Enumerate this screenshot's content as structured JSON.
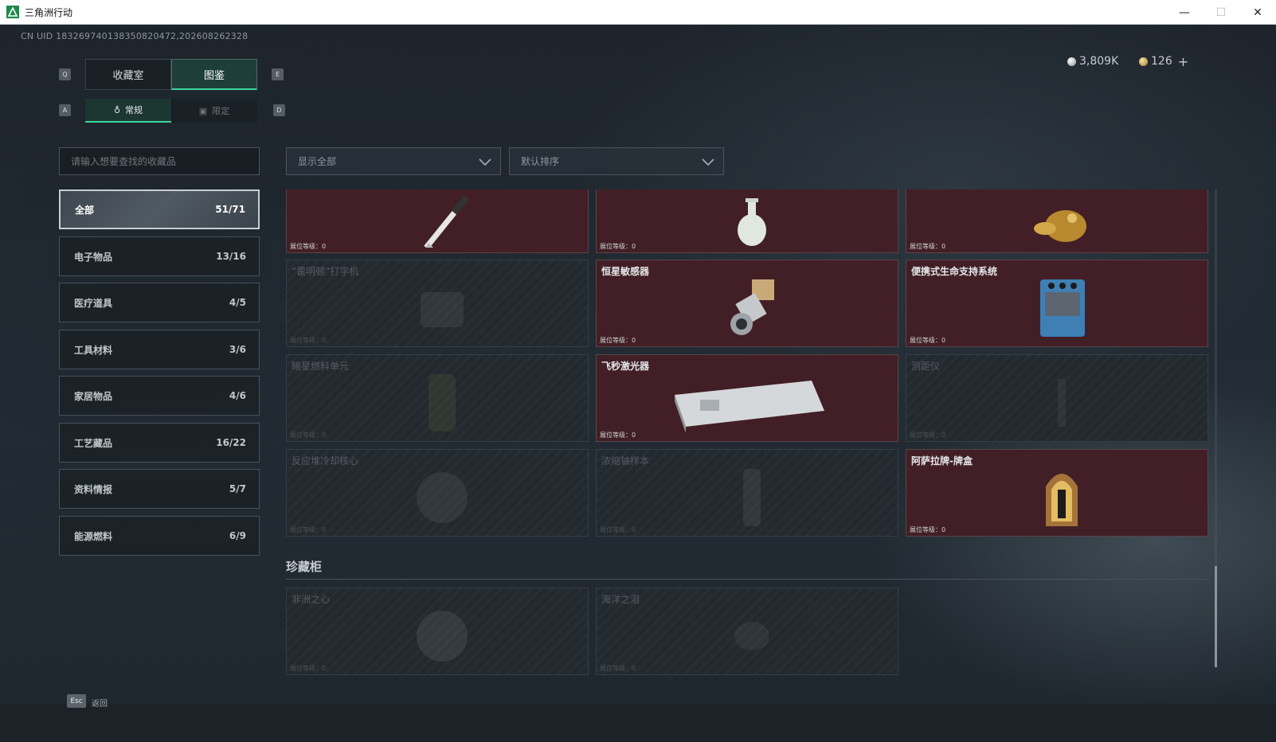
{
  "window": {
    "title": "三角洲行动"
  },
  "uid": "CN UID 183269740138350820472,202608262328",
  "currency": {
    "silver": "3,809K",
    "gold": "126",
    "add": "+"
  },
  "keys": {
    "q": "Q",
    "e": "E",
    "a": "A",
    "d": "D",
    "esc": "Esc"
  },
  "tabs": [
    {
      "label": "收藏室"
    },
    {
      "label": "图鉴"
    }
  ],
  "subtabs": [
    {
      "label": "常规"
    },
    {
      "label": "限定"
    }
  ],
  "search": {
    "placeholder": "请输入想要查找的收藏品"
  },
  "filter": {
    "label": "显示全部"
  },
  "sort": {
    "label": "默认排序"
  },
  "categories": [
    {
      "label": "全部",
      "count": "51/71"
    },
    {
      "label": "电子物品",
      "count": "13/16"
    },
    {
      "label": "医疗道具",
      "count": "4/5"
    },
    {
      "label": "工具材料",
      "count": "3/6"
    },
    {
      "label": "家居物品",
      "count": "4/6"
    },
    {
      "label": "工艺藏品",
      "count": "16/22"
    },
    {
      "label": "资料情报",
      "count": "5/7"
    },
    {
      "label": "能源燃料",
      "count": "6/9"
    }
  ],
  "level_label": "展位等级：0",
  "items": [
    {
      "name": "",
      "icon": "pen-icon"
    },
    {
      "name": "",
      "icon": "vase-icon"
    },
    {
      "name": "",
      "icon": "golden-beast-icon"
    },
    {
      "name": "“雷明顿”打字机",
      "icon": "typewriter-icon"
    },
    {
      "name": "恒星敏感器",
      "icon": "star-sensor-icon"
    },
    {
      "name": "便携式生命支持系统",
      "icon": "life-support-icon"
    },
    {
      "name": "暗星燃料单元",
      "icon": "fuel-cell-icon"
    },
    {
      "name": "飞秒激光器",
      "icon": "laser-device-icon"
    },
    {
      "name": "测距仪",
      "icon": "rangefinder-icon"
    },
    {
      "name": "反应堆冷却核心",
      "icon": "reactor-core-icon"
    },
    {
      "name": "浓缩铀样本",
      "icon": "uranium-sample-icon"
    },
    {
      "name": "阿萨拉牌-牌盒",
      "icon": "card-box-icon"
    }
  ],
  "cabinet": {
    "title": "珍藏柜",
    "items": [
      {
        "name": "非洲之心",
        "icon": "diamond-icon"
      },
      {
        "name": "海洋之泪",
        "icon": "gem-icon"
      }
    ]
  },
  "back": {
    "label": "返回"
  },
  "colors": {
    "accent": "#3dd598",
    "owned_card": "#421f26",
    "locked_card": "#22292f"
  }
}
